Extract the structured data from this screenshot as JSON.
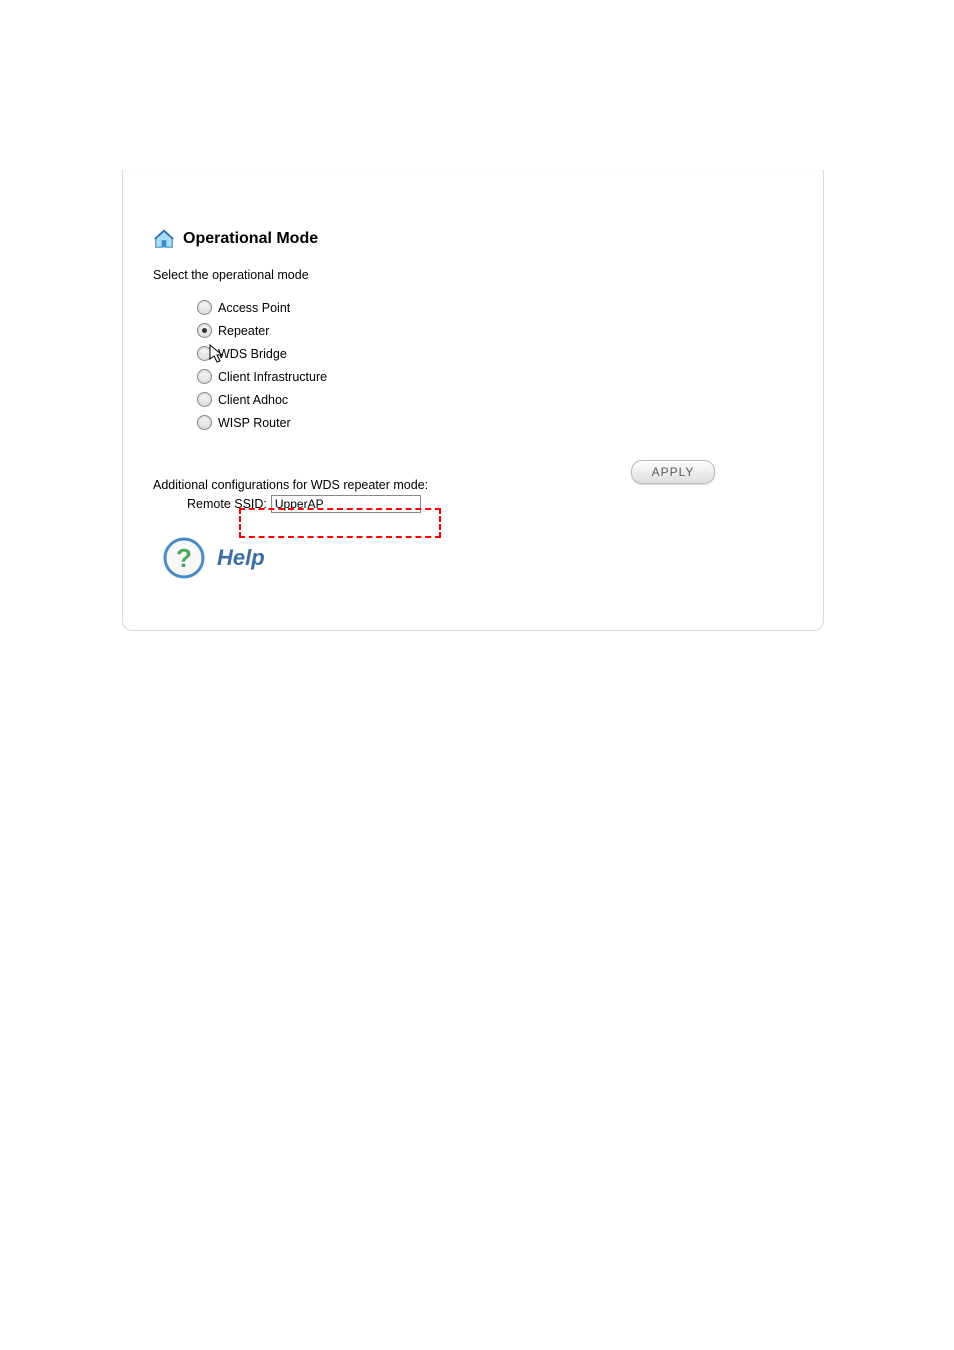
{
  "title": "Operational Mode",
  "instruction": "Select the operational mode",
  "modes": {
    "access_point": "Access Point",
    "repeater": "Repeater",
    "wds_bridge": "WDS Bridge",
    "client_infrastructure": "Client Infrastructure",
    "client_adhoc": "Client Adhoc",
    "wisp_router": "WISP Router"
  },
  "selected_mode": "repeater",
  "apply_label": "APPLY",
  "additional_label": "Additional configurations for WDS repeater mode:",
  "remote_ssid_label": "Remote SSID:",
  "remote_ssid_value": "UpperAP",
  "help_label": "Help"
}
